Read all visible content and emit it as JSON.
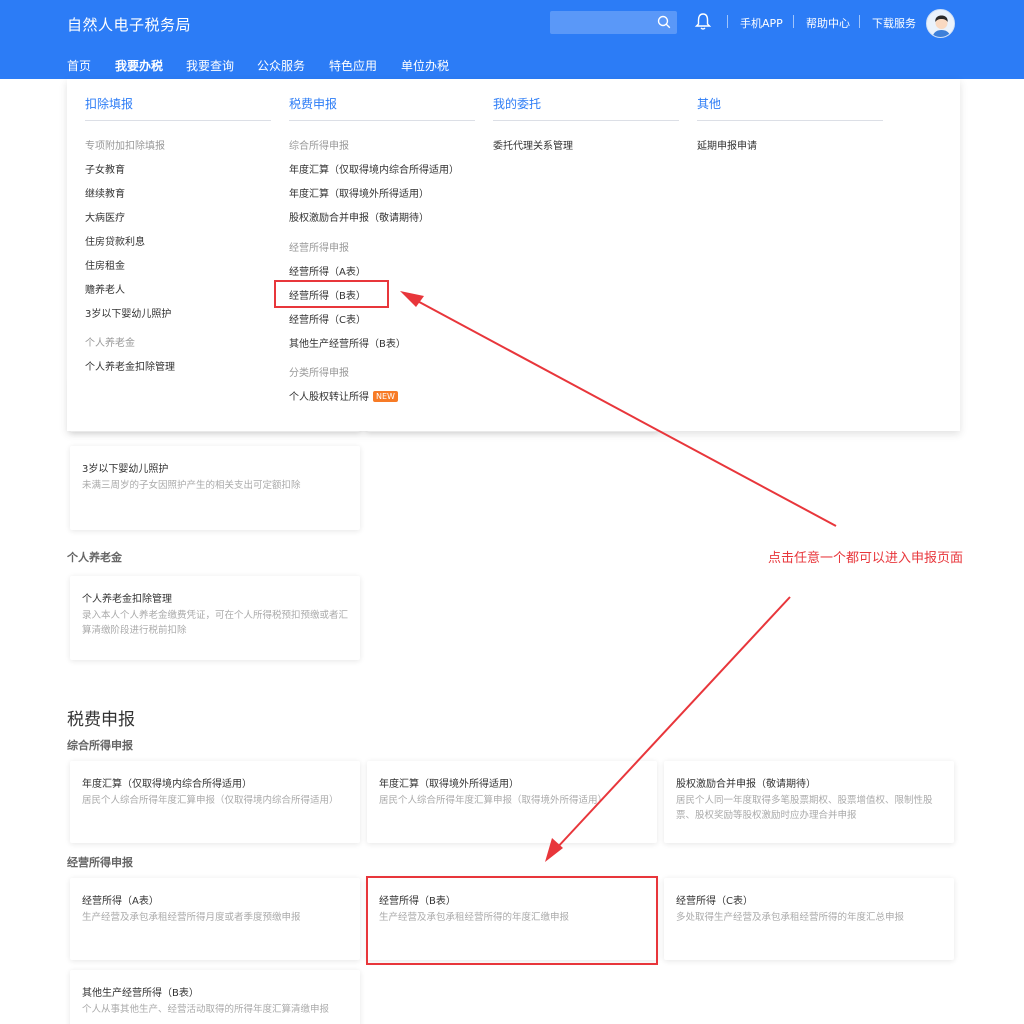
{
  "header": {
    "logo": "自然人电子税务局",
    "links": [
      "手机APP",
      "帮助中心",
      "下载服务"
    ],
    "nav": [
      "首页",
      "我要办税",
      "我要查询",
      "公众服务",
      "特色应用",
      "单位办税"
    ]
  },
  "dropdown": {
    "col1": {
      "title": "扣除填报",
      "group1": "专项附加扣除填报",
      "items1": [
        "子女教育",
        "继续教育",
        "大病医疗",
        "住房贷款利息",
        "住房租金",
        "赡养老人",
        "3岁以下婴幼儿照护"
      ],
      "group2": "个人养老金",
      "items2": [
        "个人养老金扣除管理"
      ]
    },
    "col2": {
      "title": "税费申报",
      "group1": "综合所得申报",
      "items1": [
        "年度汇算（仅取得境内综合所得适用）",
        "年度汇算（取得境外所得适用）",
        "股权激励合并申报（敬请期待）"
      ],
      "group2": "经营所得申报",
      "items2": [
        "经营所得（A表）",
        "经营所得（B表）",
        "经营所得（C表）",
        "其他生产经营所得（B表）"
      ],
      "group3": "分类所得申报",
      "items3": [
        "个人股权转让所得"
      ],
      "new_badge": "NEW"
    },
    "col3": {
      "title": "我的委托",
      "items": [
        "委托代理关系管理"
      ]
    },
    "col4": {
      "title": "其他",
      "items": [
        "延期申报申请"
      ]
    }
  },
  "cards_top": {
    "infant": {
      "title": "3岁以下婴幼儿照护",
      "desc": "未满三周岁的子女因照护产生的相关支出可定额扣除"
    },
    "pension_section": "个人养老金",
    "pension": {
      "title": "个人养老金扣除管理",
      "desc": "录入本人个人养老金缴费凭证，可在个人所得税预扣预缴或者汇算清缴阶段进行税前扣除"
    }
  },
  "tax_section": {
    "title": "税费申报",
    "comprehensive": "综合所得申报",
    "comp_cards": [
      {
        "title": "年度汇算（仅取得境内综合所得适用）",
        "desc": "居民个人综合所得年度汇算申报（仅取得境内综合所得适用）"
      },
      {
        "title": "年度汇算（取得境外所得适用）",
        "desc": "居民个人综合所得年度汇算申报（取得境外所得适用）"
      },
      {
        "title": "股权激励合并申报（敬请期待）",
        "desc": "居民个人同一年度取得多笔股票期权、股票增值权、限制性股票、股权奖励等股权激励时应办理合并申报"
      }
    ],
    "business": "经营所得申报",
    "biz_cards": [
      {
        "title": "经营所得（A表）",
        "desc": "生产经营及承包承租经营所得月度或者季度预缴申报"
      },
      {
        "title": "经营所得（B表）",
        "desc": "生产经营及承包承租经营所得的年度汇缴申报"
      },
      {
        "title": "经营所得（C表）",
        "desc": "多处取得生产经营及承包承租经营所得的年度汇总申报"
      },
      {
        "title": "其他生产经营所得（B表）",
        "desc": "个人从事其他生产、经营活动取得的所得年度汇算清缴申报"
      }
    ]
  },
  "annotation": {
    "note": "点击任意一个都可以进入申报页面",
    "color": "#e8363b"
  },
  "colors": {
    "brand": "#2c7cf6"
  }
}
